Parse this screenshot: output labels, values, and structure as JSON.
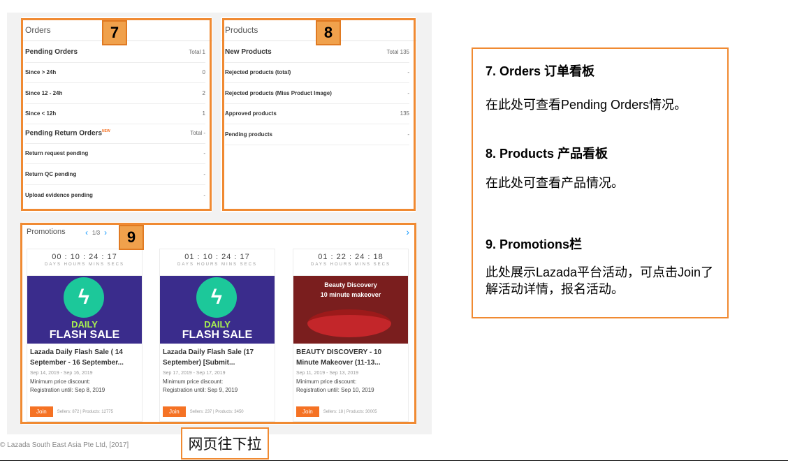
{
  "orders": {
    "title": "Orders",
    "badge": "7",
    "pending_label": "Pending Orders",
    "pending_total": "Total 1",
    "rows": [
      {
        "label": "Since > 24h",
        "value": "0"
      },
      {
        "label": "Since 12 - 24h",
        "value": "2"
      },
      {
        "label": "Since < 12h",
        "value": "1"
      }
    ],
    "return_label": "Pending Return Orders",
    "return_new_tag": "NEW",
    "return_total": "Total -",
    "return_rows": [
      {
        "label": "Return request pending",
        "value": "-"
      },
      {
        "label": "Return QC pending",
        "value": "-"
      },
      {
        "label": "Upload evidence pending",
        "value": "-"
      }
    ]
  },
  "products": {
    "title": "Products",
    "badge": "8",
    "new_label": "New Products",
    "new_total": "Total 135",
    "rows": [
      {
        "label": "Rejected products (total)",
        "value": "-"
      },
      {
        "label": "Rejected products (Miss Product Image)",
        "value": "-"
      },
      {
        "label": "Approved products",
        "value": "135"
      },
      {
        "label": "Pending products",
        "value": "-"
      }
    ]
  },
  "promotions": {
    "title": "Promotions",
    "badge": "9",
    "pager": "1/3",
    "cards": [
      {
        "timer": "00 : 10 : 24 : 17",
        "units": "DAYS HOURS MINS SECS",
        "banner_l1": "DAILY",
        "banner_l2": "FLASH SALE",
        "title": "Lazada Daily Flash Sale ( 14 September - 16 September...",
        "date": "Sep 14, 2019 - Sep 16, 2019",
        "min_discount": "Minimum price discount:",
        "registration": "Registration until: Sep 8, 2019",
        "join": "Join",
        "stats": "Sellers: 872  |  Products: 12775"
      },
      {
        "timer": "01 : 10 : 24 : 17",
        "units": "DAYS HOURS MINS SECS",
        "banner_l1": "DAILY",
        "banner_l2": "FLASH SALE",
        "title": "Lazada Daily Flash Sale (17 September) [Submit...",
        "date": "Sep 17, 2019 - Sep 17, 2019",
        "min_discount": "Minimum price discount:",
        "registration": "Registration until: Sep 9, 2019",
        "join": "Join",
        "stats": "Sellers: 237  |  Products: 3450"
      },
      {
        "timer": "01 : 22 : 24 : 18",
        "units": "DAYS HOURS MINS SECS",
        "banner_l1": "Beauty Discovery",
        "banner_l2": "10 minute makeover",
        "title": "BEAUTY DISCOVERY - 10 Minute Makeover (11-13...",
        "date": "Sep 11, 2019 - Sep 13, 2019",
        "min_discount": "Minimum price discount:",
        "registration": "Registration until: Sep 10, 2019",
        "join": "Join",
        "stats": "Sellers: 18  |  Products: 30005"
      }
    ]
  },
  "footer": {
    "copyright": "© Lazada South East Asia Pte Ltd, [2017]",
    "scroll_note": "网页往下拉"
  },
  "info": {
    "s7_title": "7. Orders 订单看板",
    "s7_body": "在此处可查看Pending Orders情况。",
    "s8_title": "8. Products 产品看板",
    "s8_body": "在此处可查看产品情况。",
    "s9_title": "9. Promotions栏",
    "s9_body": "此处展示Lazada平台活动，可点击Join了解活动详情，报名活动。"
  },
  "colors": {
    "highlight": "#f08a32",
    "join": "#f57224",
    "link": "#1a9cff"
  }
}
